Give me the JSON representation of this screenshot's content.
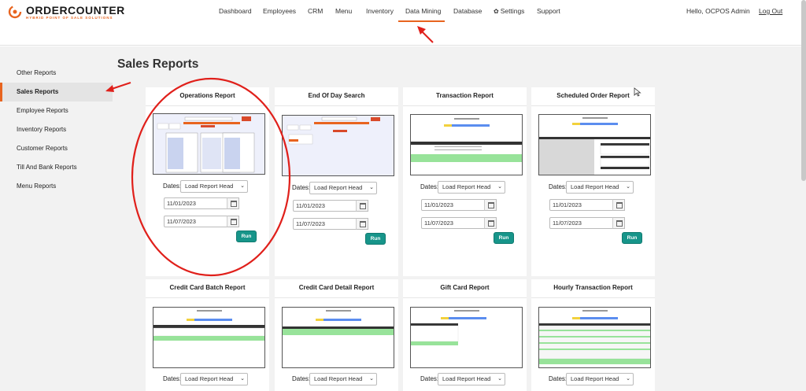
{
  "logo": {
    "name": "ORDERCOUNTER",
    "tagline": "HYBRID POINT OF SALE SOLUTIONS"
  },
  "nav": {
    "items": [
      {
        "label": "Dashboard"
      },
      {
        "label": "Employees"
      },
      {
        "label": "CRM"
      },
      {
        "label": "Menu"
      },
      {
        "label": "Inventory"
      },
      {
        "label": "Data Mining"
      },
      {
        "label": "Database"
      },
      {
        "label": "Settings"
      },
      {
        "label": "Support"
      }
    ],
    "active": "Data Mining",
    "greeting": "Hello, OCPOS Admin",
    "logout": "Log Out"
  },
  "sidebar": {
    "items": [
      {
        "label": "Other Reports"
      },
      {
        "label": "Sales Reports"
      },
      {
        "label": "Employee Reports"
      },
      {
        "label": "Inventory Reports"
      },
      {
        "label": "Customer Reports"
      },
      {
        "label": "Till And Bank Reports"
      },
      {
        "label": "Menu Reports"
      }
    ],
    "active": "Sales Reports"
  },
  "main": {
    "title": "Sales Reports",
    "dates_label": "Dates:",
    "select_value": "Load Report Head",
    "start_date": "11/01/2023",
    "end_date": "11/07/2023",
    "run_label": "Run",
    "cards": [
      {
        "title": "Operations Report"
      },
      {
        "title": "End Of Day Search"
      },
      {
        "title": "Transaction Report"
      },
      {
        "title": "Scheduled Order Report"
      },
      {
        "title": "Credit Card Batch Report"
      },
      {
        "title": "Credit Card Detail Report"
      },
      {
        "title": "Gift Card Report"
      },
      {
        "title": "Hourly Transaction Report"
      }
    ]
  },
  "colors": {
    "accent": "#e8641f",
    "run_button": "#17958a",
    "annotation": "#e0201b",
    "sidebar_bg": "#f2f2f2"
  }
}
